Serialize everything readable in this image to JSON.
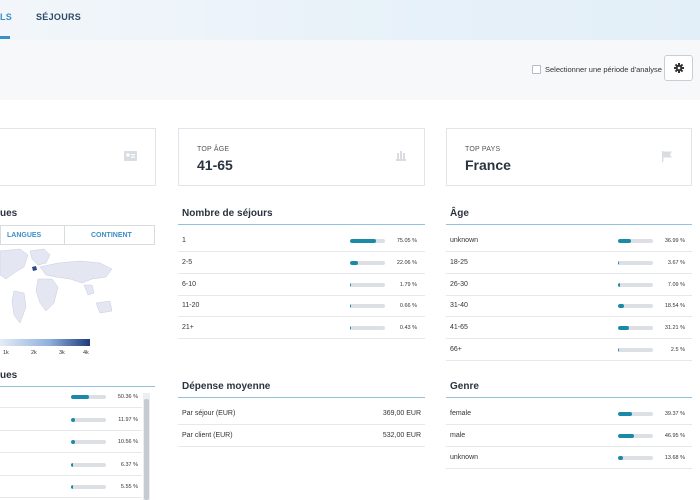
{
  "tabs": [
    {
      "label": "LS"
    },
    {
      "label": "SÉJOURS"
    }
  ],
  "filter": {
    "period_label": "Selectionner une période d'analyse"
  },
  "cards": [
    {
      "label": "TOP ÂGE",
      "value": "41-65",
      "icon": "building-icon"
    },
    {
      "label": "TOP PAYS",
      "value": "France",
      "icon": "flag-icon"
    }
  ],
  "geo": {
    "title_partial": "ues",
    "tabs": [
      "LANGUES",
      "CONTINENT"
    ],
    "legend_ticks": [
      "1k",
      "2k",
      "3k",
      "4k"
    ],
    "list_title_partial": "ues",
    "list": [
      {
        "pct": "50.36 %",
        "value": 0.5036
      },
      {
        "pct": "11.97 %",
        "value": 0.1197
      },
      {
        "pct": "10.56 %",
        "value": 0.1056
      },
      {
        "pct": "6.37 %",
        "value": 0.0637
      },
      {
        "pct": "5.55 %",
        "value": 0.0555
      }
    ]
  },
  "sejours": {
    "title": "Nombre de séjours",
    "rows": [
      {
        "label": "1",
        "pct": "75.05 %",
        "value": 0.7505
      },
      {
        "label": "2-5",
        "pct": "22.06 %",
        "value": 0.2206
      },
      {
        "label": "6-10",
        "pct": "1.79 %",
        "value": 0.0179
      },
      {
        "label": "11-20",
        "pct": "0.66 %",
        "value": 0.0066
      },
      {
        "label": "21+",
        "pct": "0.43 %",
        "value": 0.0043
      }
    ]
  },
  "depense": {
    "title": "Dépense moyenne",
    "rows": [
      {
        "label": "Par séjour (EUR)",
        "amount": "369,00 EUR"
      },
      {
        "label": "Par client (EUR)",
        "amount": "532,00 EUR"
      }
    ]
  },
  "age": {
    "title": "Âge",
    "rows": [
      {
        "label": "unknown",
        "pct": "36.99 %",
        "value": 0.3699
      },
      {
        "label": "18-25",
        "pct": "3.67 %",
        "value": 0.0367
      },
      {
        "label": "26-30",
        "pct": "7.09 %",
        "value": 0.0709
      },
      {
        "label": "31-40",
        "pct": "18.54 %",
        "value": 0.1854
      },
      {
        "label": "41-65",
        "pct": "31.21 %",
        "value": 0.3121
      },
      {
        "label": "66+",
        "pct": "2.5 %",
        "value": 0.025
      }
    ]
  },
  "genre": {
    "title": "Genre",
    "rows": [
      {
        "label": "female",
        "pct": "39.37 %",
        "value": 0.3937
      },
      {
        "label": "male",
        "pct": "46.95 %",
        "value": 0.4695
      },
      {
        "label": "unknown",
        "pct": "13.68 %",
        "value": 0.1368
      }
    ]
  },
  "colors": {
    "accent": "#3a8fc8",
    "bar_fill": "#1a8aa8",
    "bar_track": "#dcdfe3"
  }
}
